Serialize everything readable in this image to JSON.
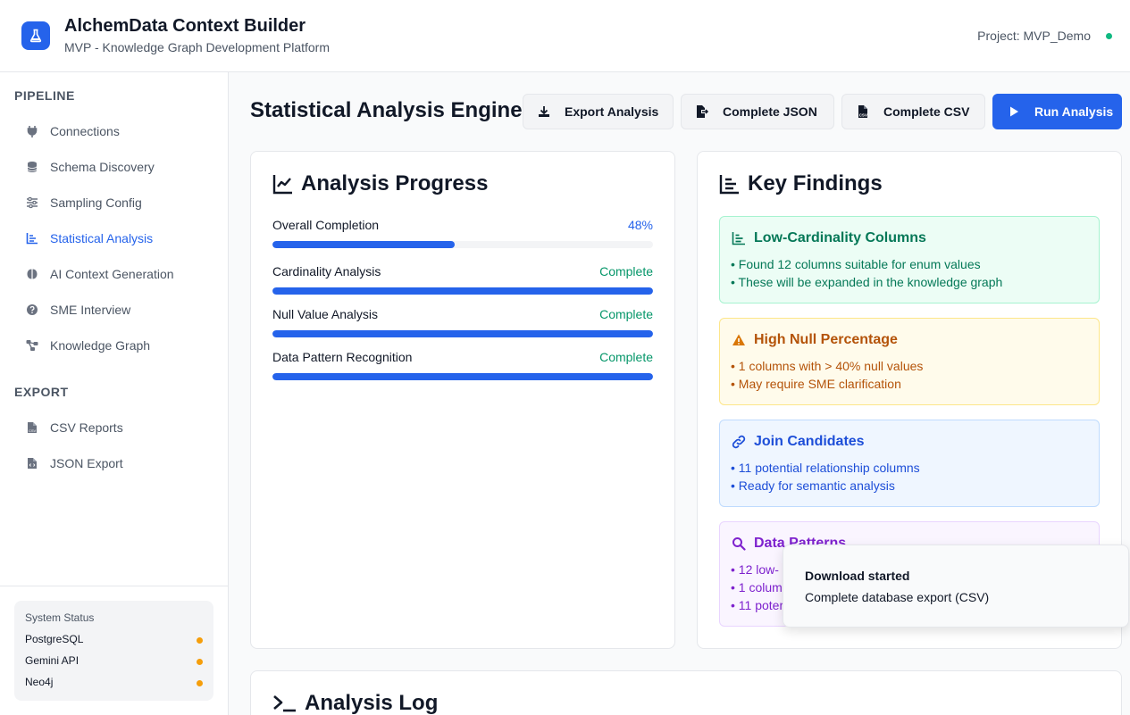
{
  "header": {
    "title": "AlchemData Context Builder",
    "subtitle": "MVP - Knowledge Graph Development Platform",
    "project": "Project: MVP_Demo",
    "logo_icon": "flask-icon"
  },
  "sidebar": {
    "pipeline_title": "PIPELINE",
    "pipeline_items": [
      {
        "label": "Connections",
        "icon": "plug-icon"
      },
      {
        "label": "Schema Discovery",
        "icon": "database-icon"
      },
      {
        "label": "Sampling Config",
        "icon": "sliders-icon"
      },
      {
        "label": "Statistical Analysis",
        "icon": "chart-bar-icon",
        "active": true
      },
      {
        "label": "AI Context Generation",
        "icon": "brain-icon"
      },
      {
        "label": "SME Interview",
        "icon": "question-icon"
      },
      {
        "label": "Knowledge Graph",
        "icon": "graph-icon"
      }
    ],
    "export_title": "EXPORT",
    "export_items": [
      {
        "label": "CSV Reports",
        "icon": "csv-file-icon"
      },
      {
        "label": "JSON Export",
        "icon": "json-file-icon"
      }
    ],
    "status": {
      "title": "System Status",
      "items": [
        {
          "label": "PostgreSQL",
          "color": "#f59e0b"
        },
        {
          "label": "Gemini API",
          "color": "#f59e0b"
        },
        {
          "label": "Neo4j",
          "color": "#f59e0b"
        }
      ]
    }
  },
  "main": {
    "title": "Statistical Analysis Engine",
    "buttons": {
      "export_analysis": "Export Analysis",
      "complete_json": "Complete JSON",
      "complete_csv": "Complete CSV",
      "run_analysis": "Run Analysis"
    },
    "progress": {
      "title": "Analysis Progress",
      "overall_label": "Overall Completion",
      "overall_value": "48%",
      "overall_fraction": 0.48,
      "items": [
        {
          "label": "Cardinality Analysis",
          "status": "Complete",
          "fraction": 1.0
        },
        {
          "label": "Null Value Analysis",
          "status": "Complete",
          "fraction": 1.0
        },
        {
          "label": "Data Pattern Recognition",
          "status": "Complete",
          "fraction": 1.0
        }
      ]
    },
    "findings": {
      "title": "Key Findings",
      "items": [
        {
          "title": "Low-Cardinality Columns",
          "lines": [
            "• Found 12 columns suitable for enum values",
            "• These will be expanded in the knowledge graph"
          ]
        },
        {
          "title": "High Null Percentage",
          "lines": [
            "• 1 columns with > 40% null values",
            "• May require SME clarification"
          ]
        },
        {
          "title": "Join Candidates",
          "lines": [
            "• 11 potential relationship columns",
            "• Ready for semantic analysis"
          ]
        },
        {
          "title": "Data Patterns",
          "lines": [
            "• 12 low-",
            "• 1 colum",
            "• 11 poter"
          ]
        }
      ]
    },
    "log": {
      "title": "Analysis Log"
    }
  },
  "toast": {
    "title": "Download started",
    "message": "Complete database export (CSV)"
  }
}
